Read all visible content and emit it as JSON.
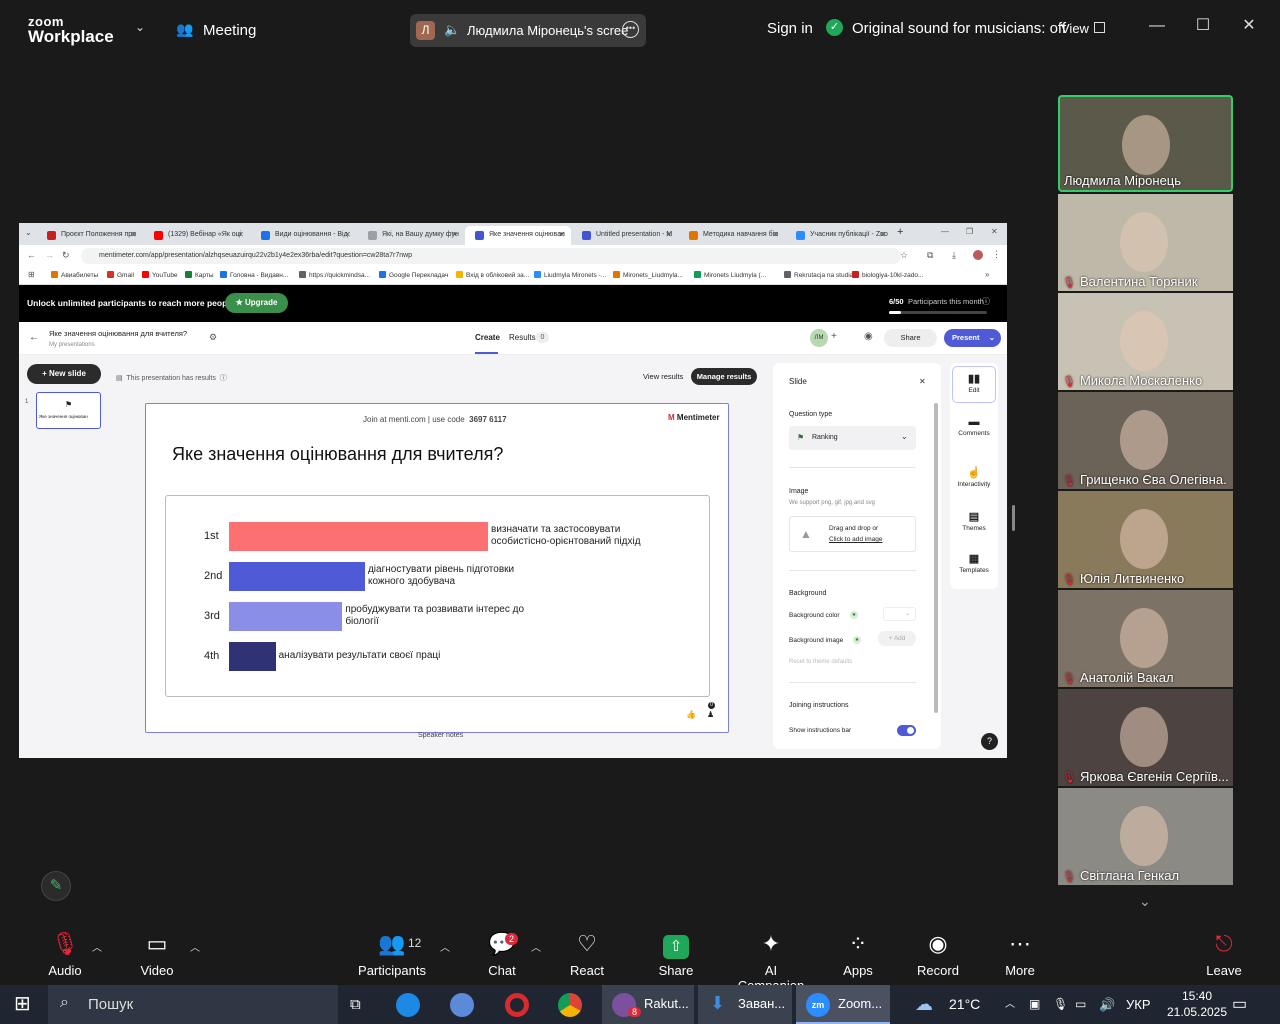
{
  "zoom": {
    "logo_top": "zoom",
    "logo_bottom": "Workplace",
    "meeting_label": "Meeting",
    "share_indicator": "Людмила Міронець's scree",
    "share_initial": "Л",
    "sign_in": "Sign in",
    "original_sound": "Original sound for musicians: off",
    "view_label": "View"
  },
  "browser": {
    "tabs": [
      {
        "label": "Проєкт Положення про",
        "color": "#c5221f"
      },
      {
        "label": "(1329) Вебінар «Як оці",
        "color": "#ff0000"
      },
      {
        "label": "Види оцінювання - Від",
        "color": "#1a73e8"
      },
      {
        "label": "Які, на Вашу думку фун",
        "color": "#9aa0a6"
      },
      {
        "label": "Яке значення оцінюван",
        "color": "#4355d4"
      },
      {
        "label": "Untitled presentation - M",
        "color": "#4355d4"
      },
      {
        "label": "Методика навчання біо",
        "color": "#e37400"
      },
      {
        "label": "Учасник публікації - Zoo",
        "color": "#2d8cff"
      }
    ],
    "url": "mentimeter.com/app/presentation/alzhqseuazuirqu22v2b1y4e2ex36rba/edit?question=cw28ta7r7nwp",
    "bookmarks": [
      "Авиабилеты",
      "Gmail",
      "YouTube",
      "Карты",
      "Головна - Видавн...",
      "https://quickmindsa...",
      "Google Перекладач",
      "Вхід в обліковий за...",
      "Liudmyla Mironets -...",
      "Mironets_Liudmyla...",
      "Mironets Liudmyla (...",
      "Rekrutacja na studia...",
      "biologiya-10kl-zado..."
    ]
  },
  "menti": {
    "upsell_text": "Unlock unlimited participants to reach more people.",
    "upgrade_label": "★ Upgrade",
    "participants_count": "6/50",
    "participants_text": "Participants this month",
    "presentation_title": "Яке значення оцінювання для вчителя?",
    "breadcrumb": "My presentations",
    "tab_create": "Create",
    "tab_results": "Results",
    "results_count": "0",
    "avatar_initials": "ЛМ",
    "share_label": "Share",
    "present_label": "Present",
    "new_slide_label": "+ New slide",
    "has_results_text": "This presentation has results",
    "view_results": "View results",
    "manage_results": "Manage results",
    "slide_number": "1",
    "thumb_text": "Яке значення оцінюван",
    "join_text": "Join at menti.com | use code",
    "join_code": "3697 6117",
    "brand": "Mentimeter",
    "question": "Яке значення оцінювання для вчителя?",
    "speaker_notes": "Speaker notes",
    "like_count": "0"
  },
  "chart_data": {
    "type": "bar",
    "categories": [
      "1st",
      "2nd",
      "3rd",
      "4th"
    ],
    "labels": [
      [
        "визначати та застосовувати",
        "особистісно-орієнтований підхід"
      ],
      [
        "діагностувати рівень підготовки",
        "кожного здобувача"
      ],
      [
        "пробуджувати та розвивати інтерес до",
        "біології"
      ],
      [
        "аналізувати результати своєї праці"
      ]
    ],
    "values": [
      4,
      2.1,
      1.75,
      0.72
    ],
    "colors": [
      "#fc7072",
      "#4f5ad6",
      "#8b8ee6",
      "#2f3275"
    ],
    "xlim": [
      0,
      4
    ]
  },
  "panel": {
    "title": "Slide",
    "question_type_label": "Question type",
    "question_type_value": "Ranking",
    "image_label": "Image",
    "image_hint": "We support png, gif, jpg and svg",
    "drag_drop": "Drag and drop or",
    "click_add": "Click to add image",
    "background_label": "Background",
    "bg_color": "Background color",
    "bg_image": "Background image",
    "add_label": "+ Add",
    "reset_label": "Reset to theme defaults",
    "joining_label": "Joining instructions",
    "show_instructions": "Show instructions bar",
    "side_icons": [
      "Edit",
      "Comments",
      "Interactivity",
      "Themes",
      "Templates"
    ]
  },
  "participants": [
    {
      "name": "Людмила Міронець",
      "muted": false,
      "bg": "#5b5a4a"
    },
    {
      "name": "Валентина Торяник",
      "muted": true,
      "bg": "#bdb8a8"
    },
    {
      "name": "Микола Москаленко",
      "muted": true,
      "bg": "#c7c2b3"
    },
    {
      "name": "Грищенко Єва Олегівна.",
      "muted": true,
      "bg": "#6b6258"
    },
    {
      "name": "Юлія Литвиненко",
      "muted": true,
      "bg": "#8a7a5c"
    },
    {
      "name": "Анатолій Вакал",
      "muted": true,
      "bg": "#7d7266"
    },
    {
      "name": "Яркова Євгенія Сергіїв...",
      "muted": true,
      "bg": "#4d4442"
    },
    {
      "name": "Світлана Генкал",
      "muted": true,
      "bg": "#8c8a84"
    }
  ],
  "toolbar": {
    "audio": "Audio",
    "video": "Video",
    "participants": "Participants",
    "participants_count": "12",
    "chat": "Chat",
    "chat_badge": "2",
    "react": "React",
    "share": "Share",
    "ai": "AI Companion",
    "apps": "Apps",
    "record": "Record",
    "more": "More",
    "leave": "Leave"
  },
  "taskbar": {
    "search": "Пошук",
    "viber_label": "Rakut...",
    "viber_badge": "8",
    "download_label": "Заван...",
    "zoom_label": "Zoom...",
    "temp": "21°C",
    "lang": "УКР",
    "time": "15:40",
    "date": "21.05.2025"
  }
}
